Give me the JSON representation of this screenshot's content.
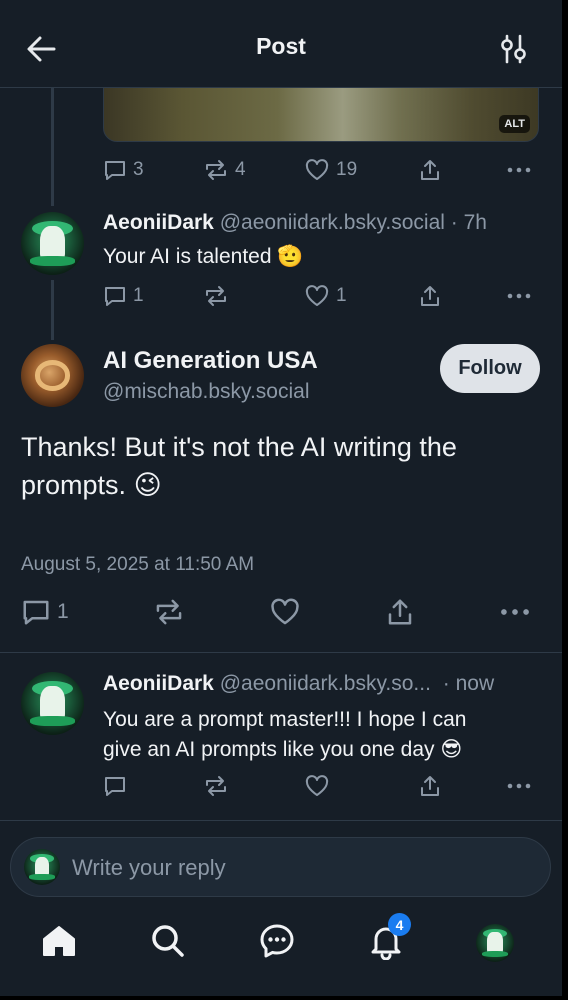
{
  "header": {
    "title": "Post"
  },
  "image_card": {
    "alt_badge": "ALT"
  },
  "parent_post_actions": {
    "replies": "3",
    "reposts": "4",
    "likes": "19"
  },
  "reply1": {
    "author": "AeoniiDark",
    "handle": "@aeoniidark.bsky.social",
    "time": "· 7h",
    "text": "Your AI is talented",
    "emoji": "🫡",
    "replies": "1",
    "likes": "1"
  },
  "main_post": {
    "author": "AI Generation USA",
    "handle": "@mischab.bsky.social",
    "follow_label": "Follow",
    "text_line1": "Thanks! But it's not the AI writing the",
    "text_line2": "prompts.",
    "emoji": "😉",
    "timestamp": "August 5, 2025 at 11:50 AM",
    "replies": "1"
  },
  "reply2": {
    "author": "AeoniiDark",
    "handle": "@aeoniidark.bsky.so...",
    "time": "· now",
    "text_line1": "You are a prompt master!!! I hope I can",
    "text_line2": "give an AI prompts like you one day",
    "emoji": "😎"
  },
  "composer": {
    "placeholder": "Write your reply"
  },
  "tabbar": {
    "notifications_badge": "4"
  },
  "colors": {
    "background": "#161e27",
    "muted": "#8c98a6",
    "badge": "#1a7cf0"
  },
  "icons": [
    "back-arrow-icon",
    "settings-sliders-icon",
    "comment-icon",
    "repost-icon",
    "heart-icon",
    "share-icon",
    "more-icon",
    "home-icon",
    "search-icon",
    "chat-icon",
    "bell-icon"
  ]
}
